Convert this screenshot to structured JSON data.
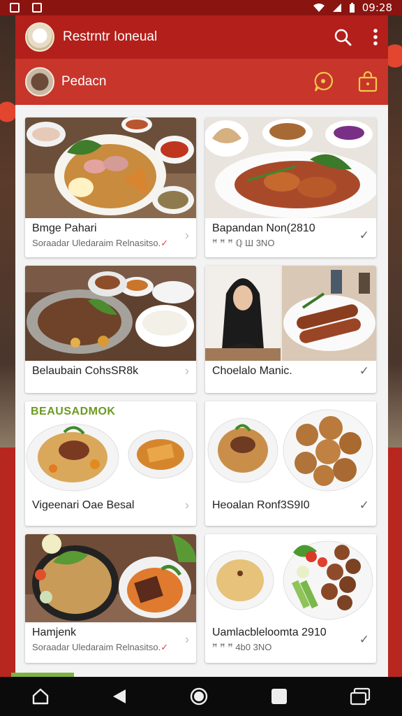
{
  "status_bar": {
    "time": "09:28"
  },
  "app_bar": {
    "title": "Restrntr Ioneual"
  },
  "sub_bar": {
    "title": "Pedacn"
  },
  "cards": [
    {
      "title": "Bmge Pahari",
      "subtitle": "Soraadar Uledaraim Relnasitso.",
      "mark": "chevron"
    },
    {
      "title": "Bapandan Non(2810",
      "subtitle": "ꟸ ꟸ ꟸ  ℚ Ш 3NO",
      "mark": "check"
    },
    {
      "title": "Belaubain CohsSR8k",
      "subtitle": "",
      "mark": "chevron"
    },
    {
      "title": "Choelalo Manic.",
      "subtitle": "",
      "mark": "check"
    },
    {
      "title": "Vigeenari Oae Besal",
      "subtitle": "",
      "mark": "chevron",
      "tag": "BEAUSADMOK"
    },
    {
      "title": "Heoalan Ronf3S9I0",
      "subtitle": "",
      "mark": "check"
    },
    {
      "title": "Hamjenk",
      "subtitle": "Soraadar Uledaraim Relnasitso.",
      "mark": "chevron"
    },
    {
      "title": "Uamlacbleloomta 2910",
      "subtitle": "ꟸ ꟸ ꟸ  4b0 3NO",
      "mark": "check"
    }
  ],
  "icons": {
    "search": "search-icon",
    "more": "more-vert-icon",
    "chat": "chat-bubble-icon",
    "bag": "shopping-bag-icon",
    "home": "home-icon",
    "back": "back-icon",
    "circle": "home-circle-icon",
    "square": "recents-icon",
    "windows": "windows-icon"
  },
  "colors": {
    "primary": "#b31f1a",
    "secondary": "#c8352b",
    "accent": "#f2c94c"
  }
}
